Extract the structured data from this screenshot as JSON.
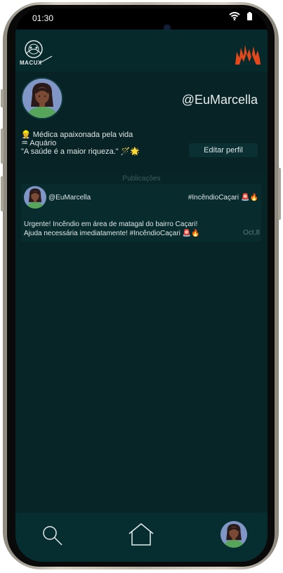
{
  "status_bar": {
    "time": "01:30"
  },
  "header": {
    "logo_text": "MACUX"
  },
  "profile": {
    "username": "@EuMarcella",
    "bio_line1": "👷 Médica apaixonada pela vida",
    "bio_line2": "♒ Aquário",
    "bio_line3": "\"A saúde é a maior riqueza.\" 🪄🌟",
    "edit_button": "Editar perfil"
  },
  "section_title": "Publicações",
  "post": {
    "username": "@EuMarcella",
    "hashtag": "#IncêndioCaçari",
    "hashtag_emoji": "🚨🔥",
    "text_line1": "Urgente! Incêndio em área de matagal do bairro Caçari!",
    "text_line2": "Ajuda necessária imediatamente! #IncêndioCaçari 🚨🔥",
    "date": "Oct,8"
  },
  "colors": {
    "background": "#072427",
    "header": "#062a2c",
    "post_card": "#082b2e",
    "accent_fire": "#e4481b",
    "avatar_shirt": "#56a55b"
  }
}
